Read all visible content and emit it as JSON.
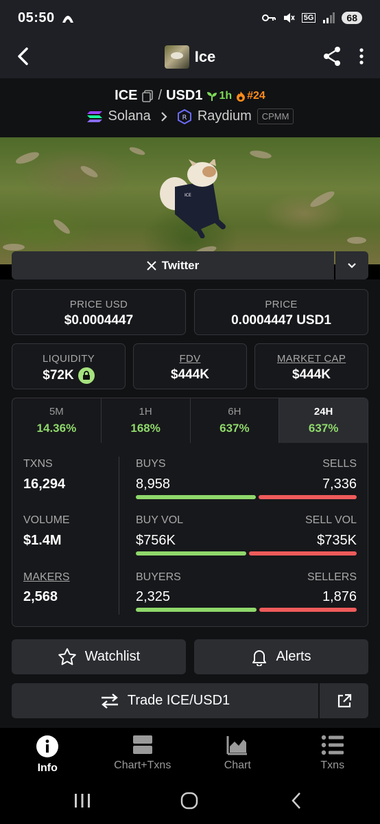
{
  "status": {
    "time": "05:50",
    "network": "5G",
    "battery": "68"
  },
  "header": {
    "title": "Ice"
  },
  "pair": {
    "base": "ICE",
    "quote": "USD1",
    "age": "1h",
    "rank": "#24",
    "chain": "Solana",
    "dex": "Raydium",
    "pool_type": "CPMM"
  },
  "social": {
    "twitter_label": "Twitter"
  },
  "prices": {
    "price_usd_label": "PRICE USD",
    "price_usd": "$0.0004447",
    "price_label": "PRICE",
    "price": "0.0004447 USD1"
  },
  "metrics": {
    "liquidity_label": "LIQUIDITY",
    "liquidity": "$72K",
    "fdv_label": "FDV",
    "fdv": "$444K",
    "mcap_label": "MARKET CAP",
    "mcap": "$444K"
  },
  "timeframes": [
    {
      "label": "5M",
      "change": "14.36%"
    },
    {
      "label": "1H",
      "change": "168%"
    },
    {
      "label": "6H",
      "change": "637%"
    },
    {
      "label": "24H",
      "change": "637%"
    }
  ],
  "stats": {
    "txns_label": "TXNS",
    "txns": "16,294",
    "volume_label": "VOLUME",
    "volume": "$1.4M",
    "makers_label": "MAKERS",
    "makers": "2,568",
    "buys_label": "BUYS",
    "buys": "8,958",
    "sells_label": "SELLS",
    "sells": "7,336",
    "buys_fraction": 0.55,
    "buyvol_label": "BUY VOL",
    "buyvol": "$756K",
    "sellvol_label": "SELL VOL",
    "sellvol": "$735K",
    "buyvol_fraction": 0.507,
    "buyers_label": "BUYERS",
    "buyers": "2,325",
    "sellers_label": "SELLERS",
    "sellers": "1,876",
    "buyers_fraction": 0.553
  },
  "actions": {
    "watchlist": "Watchlist",
    "alerts": "Alerts",
    "trade": "Trade ICE/USD1"
  },
  "tabs": [
    {
      "label": "Info",
      "icon": "info-icon"
    },
    {
      "label": "Chart+Txns",
      "icon": "split-icon"
    },
    {
      "label": "Chart",
      "icon": "chart-icon"
    },
    {
      "label": "Txns",
      "icon": "list-icon"
    }
  ],
  "colors": {
    "buy": "#8fd86b",
    "sell": "#ef5b5b",
    "age": "#7ed957",
    "rank": "#ff8c1a"
  }
}
